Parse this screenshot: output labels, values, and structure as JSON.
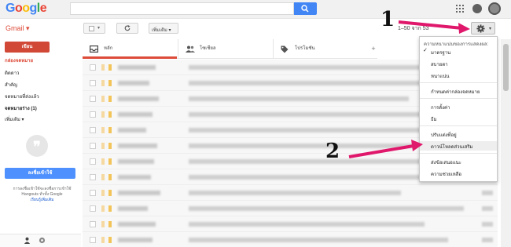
{
  "header": {
    "logo_letters": [
      {
        "ch": "G",
        "color": "#4285f4"
      },
      {
        "ch": "o",
        "color": "#ea4335"
      },
      {
        "ch": "o",
        "color": "#fbbc05"
      },
      {
        "ch": "g",
        "color": "#4285f4"
      },
      {
        "ch": "l",
        "color": "#34a853"
      },
      {
        "ch": "e",
        "color": "#ea4335"
      }
    ],
    "search_placeholder": ""
  },
  "toolbar": {
    "app_label": "Gmail ▾",
    "more_label": "เพิ่มเติม ▾",
    "pager_text": "1–50 จาก 53"
  },
  "sidebar": {
    "compose_label": "เขียน",
    "items": [
      {
        "label": "กล่องจดหมาย",
        "state": "active"
      },
      {
        "label": "ติดดาว",
        "state": ""
      },
      {
        "label": "สำคัญ",
        "state": ""
      },
      {
        "label": "จดหมายที่ส่งแล้ว",
        "state": ""
      },
      {
        "label": "จดหมายร่าง (1)",
        "state": "bold"
      },
      {
        "label": "เพิ่มเติม ▾",
        "state": ""
      }
    ],
    "hangouts_button": "ลงชื่อเข้าใช้",
    "hangouts_text": "การลงชื่อเข้าใช้จะลงชื่อการเข้าใช้ Hangouts ทั่วทั้ง Google",
    "hangouts_link": "เรียนรู้เพิ่มเติม"
  },
  "tabs": [
    {
      "label": "หลัก",
      "icon": "inbox-icon"
    },
    {
      "label": "โซเชียล",
      "icon": "people-icon"
    },
    {
      "label": "โปรโมชัน",
      "icon": "tag-icon"
    }
  ],
  "tab_add": "+",
  "settings_menu": {
    "header": "ความหนาแน่นของการแสดงผล:",
    "density_options": [
      {
        "label": "มาตรฐาน",
        "checked": true
      },
      {
        "label": "สบายตา",
        "checked": false
      },
      {
        "label": "หนาแน่น",
        "checked": false
      }
    ],
    "configure_inbox": "กำหนดค่ากล่องจดหมาย",
    "settings": "การตั้งค่า",
    "themes": "ธีม",
    "offline": "ปรับแต่งที่อยู่",
    "addons": "ดาวน์โหลดส่วนเสริม",
    "feedback": "ส่งข้อเสนอแนะ",
    "help": "ความช่วยเหลือ"
  },
  "annotations": {
    "step1": "1",
    "step2": "2",
    "arrow_color": "#e0186c"
  },
  "colors": {
    "accent_red": "#dd4b39",
    "search_blue": "#4285f4",
    "hangout_blue": "#4d90fe"
  },
  "email_rows": 12
}
